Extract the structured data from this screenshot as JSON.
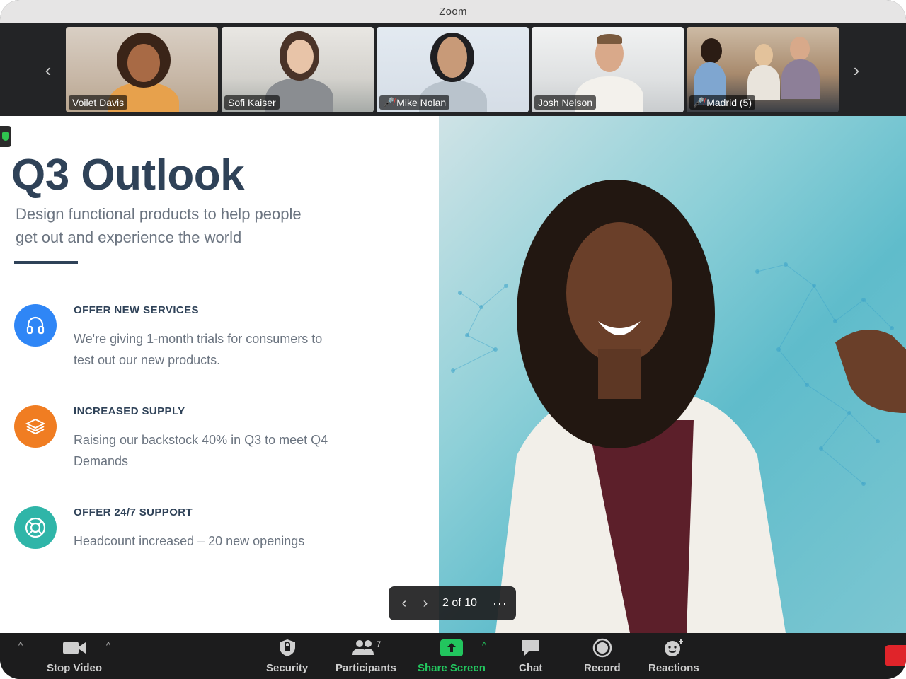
{
  "window": {
    "title": "Zoom"
  },
  "gallery": {
    "participants": [
      {
        "name": "Voilet Davis",
        "muted": false
      },
      {
        "name": "Sofi Kaiser",
        "muted": false
      },
      {
        "name": "Mike Nolan",
        "muted": true
      },
      {
        "name": "Josh Nelson",
        "muted": false
      },
      {
        "name": "Madrid (5)",
        "muted": true
      }
    ]
  },
  "slide": {
    "title": "Q3 Outlook",
    "subtitle": "Design functional products to help people get out and experience the world",
    "features": [
      {
        "icon": "headphones-icon",
        "title": "OFFER NEW SERVICES",
        "description": "We're giving 1-month trials for consumers to test out our new products.",
        "color": "#2f86f6"
      },
      {
        "icon": "layers-icon",
        "title": "INCREASED SUPPLY",
        "description": "Raising our backstock 40% in Q3 to meet Q4 Demands",
        "color": "#f07d22"
      },
      {
        "icon": "lifebuoy-icon",
        "title": "OFFER 24/7 SUPPORT",
        "description": "Headcount increased – 20 new openings",
        "color": "#2fb5a8"
      }
    ]
  },
  "slide_nav": {
    "page": "2 of 10",
    "more": "···"
  },
  "toolbar": {
    "stop_video": "Stop Video",
    "security": "Security",
    "participants": "Participants",
    "participants_count": "7",
    "share_screen": "Share Screen",
    "chat": "Chat",
    "record": "Record",
    "reactions": "Reactions"
  },
  "colors": {
    "accent_green": "#22c55e",
    "end_red": "#e0242a",
    "slide_heading": "#2f4258"
  }
}
